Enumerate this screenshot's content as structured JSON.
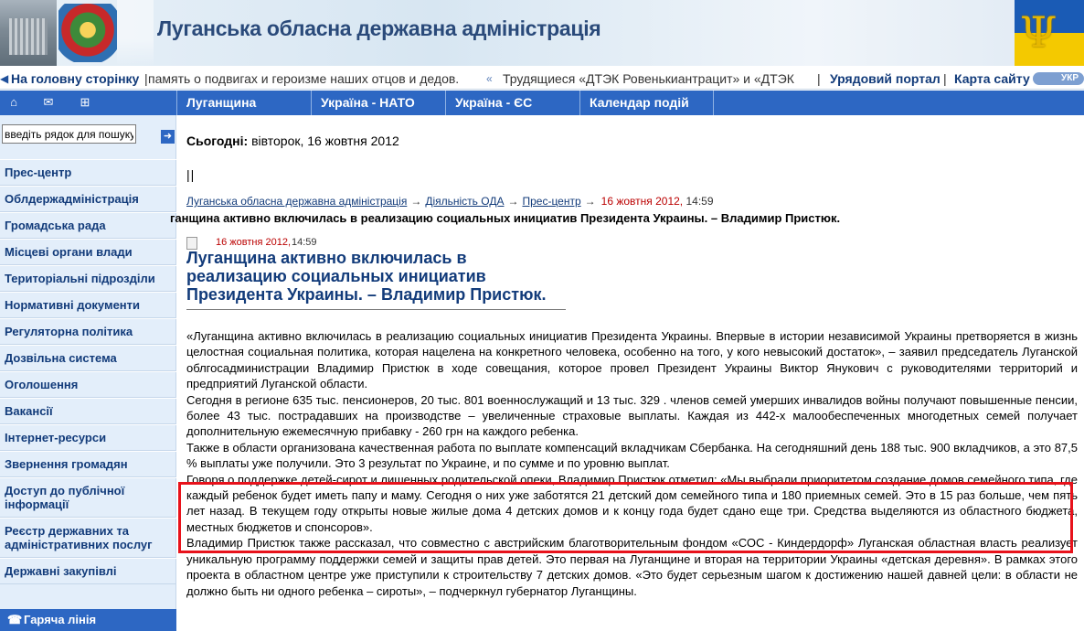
{
  "header": {
    "title": "Луганська обласна державна адміністрація"
  },
  "ticker": {
    "home": "На головну сторінку",
    "message1": "память о подвигах и героизме наших отцов и дедов.",
    "message2": "Трудящиеся «ДТЭК Ровенькиантрацит» и «ДТЭК",
    "portal": "Урядовий портал",
    "sitemap": "Карта сайту",
    "lang": "УКР"
  },
  "topnav": {
    "tabs": [
      "Луганщина",
      "Україна - НАТО",
      "Україна - ЄС",
      "Календар подій"
    ]
  },
  "sidebar": {
    "search_placeholder": "введіть рядок для пошуку",
    "items": [
      "Прес-центр",
      "Облдержадміністрація",
      "Громадська рада",
      "Місцеві органи влади",
      "Територіальні підрозділи",
      "Нормативні документи",
      "Регуляторна політика",
      "Дозвільна система",
      "Оголошення",
      "Вакансії",
      "Інтернет-ресурси",
      "Звернення громадян",
      "Доступ до публічної інформації",
      "Реєстр державних та адміністративних послуг",
      "Державні закупівлі"
    ],
    "hotline": "Гаряча лінія"
  },
  "main": {
    "today_label": "Сьогодні:",
    "today_value": "вівторок, 16 жовтня 2012",
    "pipes": "||",
    "breadcrumb": [
      "Луганська обласна державна адміністрація",
      "Діяльність ОДА",
      "Прес-центр"
    ],
    "breadcrumb_date": "16 жовтня 2012,",
    "breadcrumb_time": "14:59",
    "headline": "ганщина активно включилась в реализацию социальных инициатив Президента Украины. – Владимир Пристюк.",
    "article_date": "16 жовтня 2012,",
    "article_time": "14:59",
    "article_title": "Луганщина активно включилась в реализацию социальных инициатив Президента Украины. – Владимир Пристюк.",
    "paragraphs": [
      "«Луганщина активно включилась в реализацию социальных инициатив Президента Украины. Впервые в истории независимой Украины претворяется в жизнь целостная социальная политика, которая нацелена на конкретного человека, особенно на того, у кого невысокий достаток», – заявил председатель Луганской облгосадминистрации Владимир Пристюк в ходе совещания, которое провел Президент Украины Виктор Янукович с руководителями территорий и предприятий Луганской области.",
      "Сегодня в регионе 635 тыс. пенсионеров, 20 тыс. 801 военнослужащий и 13 тыс. 329 . членов семей умерших инвалидов войны получают повышенные пенсии, более 43 тыс. пострадавших на производстве – увеличенные страховые выплаты. Каждая из 442-х малообеспеченных многодетных семей получает дополнительную ежемесячную прибавку - 260 грн на каждого ребенка.",
      "Также в области организована качественная работа по выплате компенсаций вкладчикам Сбербанка. На сегодняшний день 188 тыс. 900 вкладчиков, а это 87,5 % выплаты уже получили. Это 3 результат по Украине, и по сумме и по уровню выплат.",
      "Говоря о поддержке детей-сирот и лишенных родительской опеки, Владимир Пристюк отметил: «Мы выбрали приоритетом создание домов семейного типа, где каждый ребенок будет иметь папу и маму. Сегодня о них уже заботятся 21 детский дом семейного типа и 180 приемных семей. Это в 15 раз больше, чем пять лет назад. В текущем году открыты новые жилые дома 4 детских домов и к концу года будет сдано еще три. Средства выделяются из областного бюджета, местных бюджетов и спонсоров».",
      "Владимир Пристюк также рассказал, что совместно с австрийским благотворительным фондом «СОС - Киндердорф» Луганская областная власть реализует уникальную программу поддержки семей и защиты прав детей. Это первая на Луганщине и вторая на территории Украины «детская деревня». В рамках этого проекта в областном центре уже приступили к строительству 7 детских домов. «Это будет серьезным шагом к достижению нашей давней цели: в области не должно быть ни одного ребенка – сироты», – подчеркнул губернатор Луганщины."
    ]
  },
  "colors": {
    "nav_blue": "#2d67c3",
    "link_blue": "#123b7a",
    "date_red": "#b00",
    "highlight_red": "#e8121b"
  },
  "icons": [
    "home-icon",
    "mail-icon",
    "sitemap-icon",
    "search-go-icon",
    "arrow-icon",
    "phone-icon",
    "document-icon"
  ]
}
